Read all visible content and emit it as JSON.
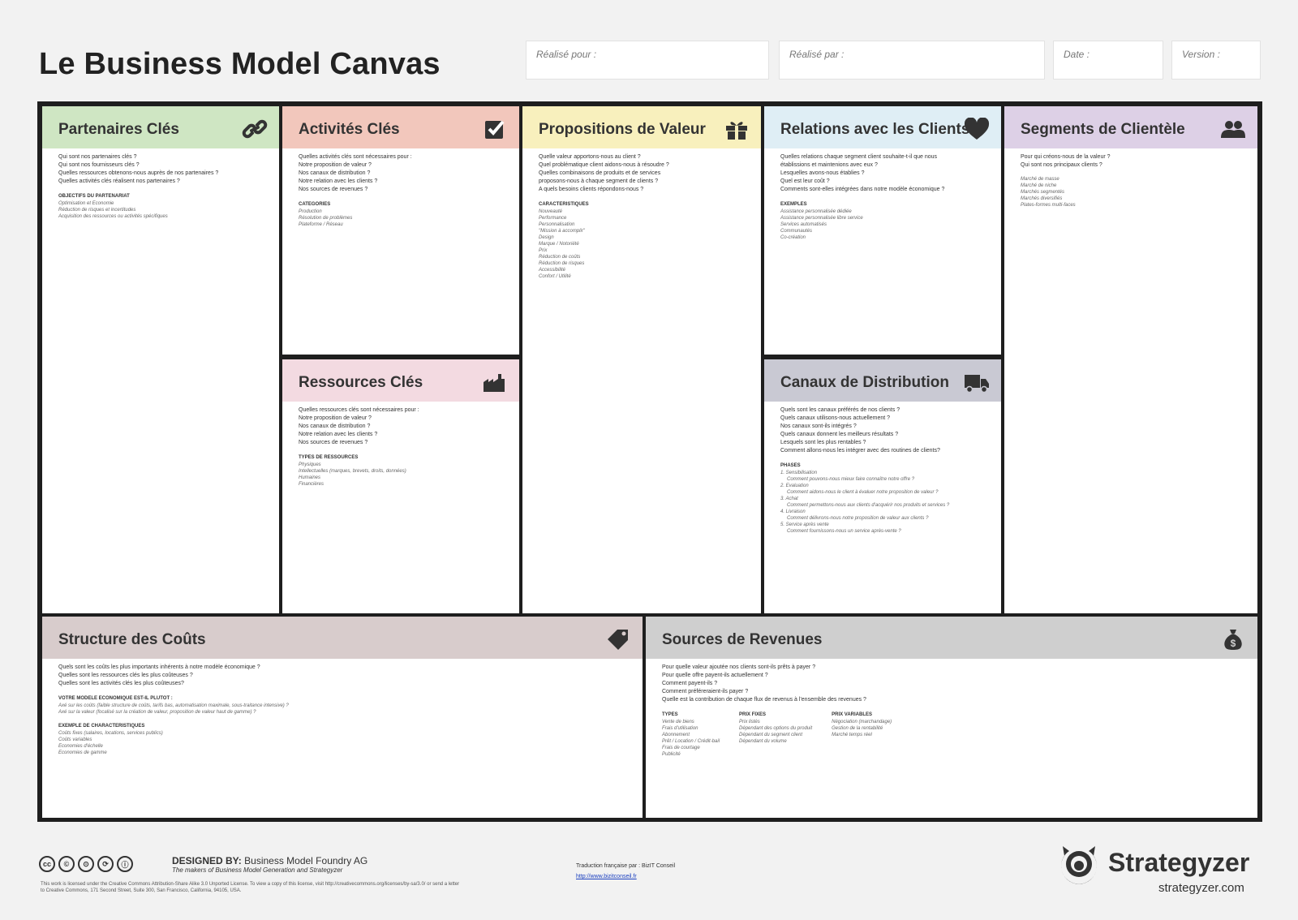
{
  "title": "Le Business Model Canvas",
  "fields": [
    {
      "label": "Réalisé pour :"
    },
    {
      "label": "Réalisé par :"
    },
    {
      "label": "Date :"
    },
    {
      "label": "Version :"
    }
  ],
  "colors": {
    "partenaires": "#cfe6c3",
    "activites": "#f2c7bc",
    "propositions": "#f8f0bd",
    "relations": "#dfeef5",
    "segments": "#ddd0e6",
    "ressources": "#f3dae1",
    "canaux": "#c9c9d3",
    "couts": "#d8cccc",
    "revenus": "#cfcfcf"
  },
  "blocks": {
    "partenaires": {
      "title": "Partenaires Clés",
      "icon": "link-icon",
      "questions": [
        "Qui sont nos partenaires clés ?",
        "Qui sont nos fournisseurs clés ?",
        "Quelles ressources obtenons-nous auprès de nos partenaires ?",
        "Quelles activités clés réalisent nos partenaires ?"
      ],
      "section": "OBJECTIFS DU PARTENARIAT",
      "items": [
        "Optimisation et Economie",
        "Réduction de risques et incertitudes",
        "Acquisition des ressources ou activités spécifiques"
      ]
    },
    "activites": {
      "title": "Activités Clés",
      "icon": "checkbox-icon",
      "questions": [
        "Quelles activités clés sont nécessaires pour :",
        "Notre proposition de valeur ?",
        "Nos canaux de distribution ?",
        "Notre relation avec les clients ?",
        "Nos sources de revenues ?"
      ],
      "section": "CATEGORIES",
      "items": [
        "Production",
        "Résolution de problèmes",
        "Plateforme / Réseau"
      ]
    },
    "propositions": {
      "title": "Propositions de Valeur",
      "icon": "gift-icon",
      "questions": [
        "Quelle valeur apportons-nous au client ?",
        "Quel problématique client aidons-nous à résoudre ?",
        "Quelles combinaisons de produits et de services",
        "proposons-nous à chaque segment de clients ?",
        "A quels besoins clients répondons-nous ?"
      ],
      "section": "CARACTERISTIQUES",
      "items": [
        "Nouveauté",
        "Performance",
        "Personnalisation",
        "\"Mission à accomplir\"",
        "Design",
        "Marque / Notoriété",
        "Prix",
        "Réduction de coûts",
        "Réduction de risques",
        "Accessibilité",
        "Confort / Utilité"
      ]
    },
    "relations": {
      "title": "Relations avec les Clients",
      "icon": "heart-icon",
      "questions": [
        "Quelles relations chaque segment client souhaite-t-il que nous",
        "établissions et maintenions avec eux ?",
        "Lesquelles avons-nous établies ?",
        "Quel est leur coût ?",
        "Comments sont-elles intégrées dans notre modèle économique ?"
      ],
      "section": "EXEMPLES",
      "items": [
        "Assistance personnalisée dédiée",
        "Assistance personnalisée libre service",
        "Services automatisés",
        "Communautés",
        "Co-création"
      ]
    },
    "segments": {
      "title": "Segments de Clientèle",
      "icon": "people-icon",
      "questions": [
        "Pour qui créons-nous de la valeur ?",
        "Qui sont nos principaux clients ?"
      ],
      "items": [
        "Marché de masse",
        "Marché de niche",
        "Marchés segmentés",
        "Marchés diversifiés",
        "Plates-formes multi-faces"
      ]
    },
    "ressources": {
      "title": "Ressources Clés",
      "icon": "factory-icon",
      "questions": [
        "Quelles ressources clés sont nécessaires pour :",
        "Notre proposition de valeur ?",
        "Nos canaux de distribution ?",
        "Notre relation avec les clients ?",
        "Nos sources de revenues ?"
      ],
      "section": "TYPES DE RESSOURCES",
      "items": [
        "Physiques",
        "Intellectuelles (marques, brevets, droits, données)",
        "Humaines",
        "Financières"
      ]
    },
    "canaux": {
      "title": "Canaux de Distribution",
      "icon": "truck-icon",
      "questions": [
        "Quels sont les canaux préférés de nos clients ?",
        "Quels canaux utilisons-nous actuellement ?",
        "Nos canaux sont-ils intégrés ?",
        "Quels canaux donnent les meilleurs résultats ?",
        "Lesquels sont les plus rentables ?",
        "Comment allons-nous les intégrer avec des routines de clients?"
      ],
      "section": "PHASES",
      "phases": [
        {
          "n": "1. Sensibilisation",
          "d": "Comment pouvons-nous mieux faire connaître notre offre ?"
        },
        {
          "n": "2. Evaluation",
          "d": "Comment aidons-nous le client à évaluer notre proposition de valeur ?"
        },
        {
          "n": "3. Achat",
          "d": "Comment permettons-nous aux clients d'acquérir nos produits et services ?"
        },
        {
          "n": "4. Livraison",
          "d": "Comment délivrons-nous notre proposition de valeur aux clients ?"
        },
        {
          "n": "5. Service après vente",
          "d": "Comment fournissons-nous un service après-vente ?"
        }
      ]
    },
    "couts": {
      "title": "Structure des Coûts",
      "icon": "price-tag-icon",
      "questions": [
        "Quels sont les coûts les plus importants inhérents à notre modèle économique ?",
        "Quelles sont les ressources clés les plus coûteuses ?",
        "Quelles sont les activités clés les plus coûteuses?"
      ],
      "section": "VOTRE MODELE ECONOMIQUE EST-IL PLUTOT :",
      "items": [
        "Axé sur les coûts (faible structure de coûts, tarifs bas, automatisation maximale, sous-traitance intensive) ?",
        "Axé sur la valeur (focalisé sur la création de valeur, proposition de valeur haut de gamme) ?"
      ],
      "section2": "EXEMPLE DE CHARACTERISTIQUES",
      "items2": [
        "Coûts fixes (salaires, locations, services publics)",
        "Coûts variables",
        "Economies d'échelle",
        "Economies de gamme"
      ]
    },
    "revenus": {
      "title": "Sources de Revenues",
      "icon": "money-bag-icon",
      "questions": [
        "Pour quelle valeur ajoutée nos clients sont-ils prêts à payer ?",
        "Pour quelle offre payent-ils actuellement ?",
        "Comment payent-ils ?",
        "Comment préféreraient-ils payer ?",
        "Quelle est la contribution de chaque flux de revenus à l'ensemble des revenues ?"
      ],
      "columns": [
        {
          "head": "TYPES",
          "items": [
            "Vente de biens",
            "Frais d'utilisation",
            "Abonnement",
            "Prêt / Location / Crédit-bail",
            "Frais de courtage",
            "Publicité"
          ]
        },
        {
          "head": "PRIX FIXES",
          "items": [
            "Prix listés",
            "Dépendant des options du produit",
            "Dépendant du segment client",
            "Dépendant du volume"
          ]
        },
        {
          "head": "PRIX VARIABLES",
          "items": [
            "Négociation (marchandage)",
            "Gestion de la rentabilité",
            "Marché temps réel"
          ]
        }
      ]
    }
  },
  "footer": {
    "designed_prefix": "DESIGNED BY:",
    "designed_by": "Business Model Foundry AG",
    "makers": "The makers of Business Model Generation and Strategyzer",
    "license": "This work is licensed under the Creative Commons Attribution-Share Alike 3.0 Unported License. To view a copy of this license, visit http://creativecommons.org/licenses/by-sa/3.0/ or send a letter to Creative Commons, 171 Second Street, Suite 300, San Francisco, California, 94105, USA.",
    "translation": "Traduction française par : BizIT Conseil",
    "translation_link": "http://www.bizitconseil.fr",
    "brand": "Strategyzer",
    "brand_url": "strategyzer.com"
  }
}
